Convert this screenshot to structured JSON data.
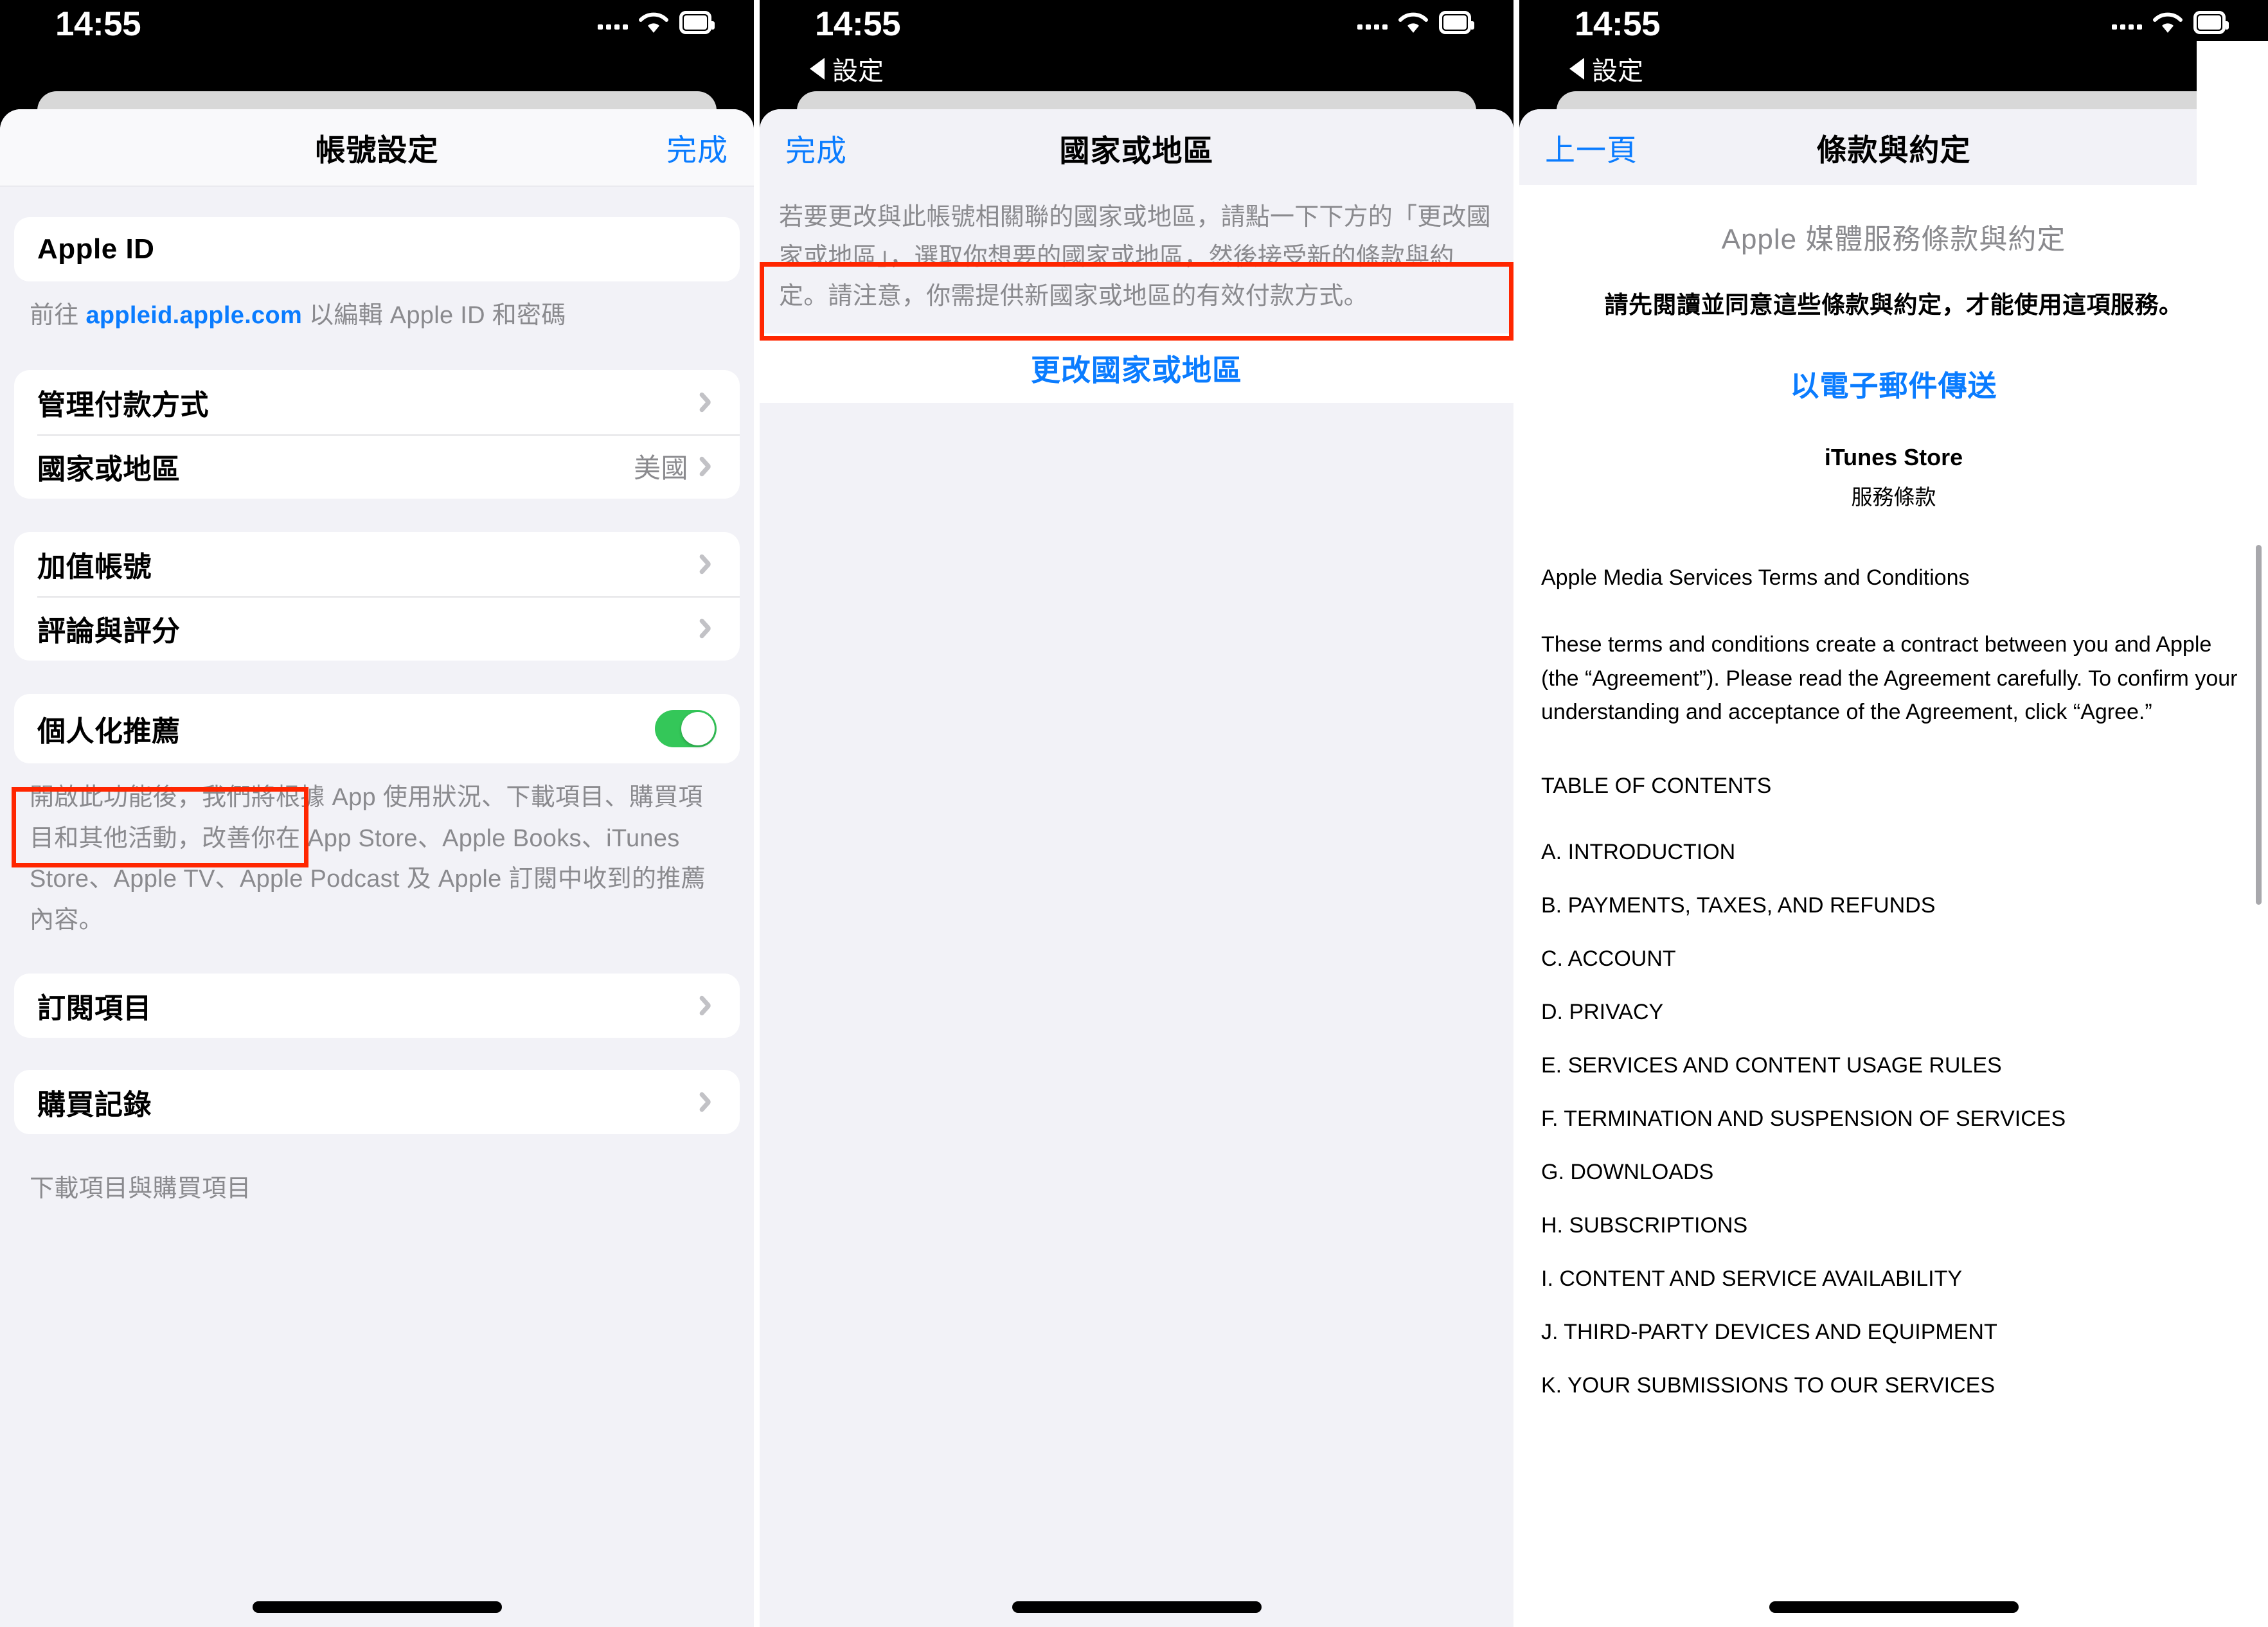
{
  "statusbar": {
    "time": "14:55",
    "signal_dots": 4,
    "wifi_icon": "wifi-icon",
    "battery_icon": "battery-icon"
  },
  "back_chip": {
    "label": "設定",
    "icon": "back-triangle-icon"
  },
  "panel1": {
    "nav": {
      "title": "帳號設定",
      "done_label": "完成"
    },
    "apple_id_row": {
      "label": "Apple ID"
    },
    "apple_id_footnote": {
      "prefix": "前往 ",
      "link": "appleid.apple.com",
      "suffix": " 以編輯 Apple ID 和密碼"
    },
    "group_a": [
      {
        "label": "管理付款方式",
        "value": "",
        "accessory": "chevron"
      },
      {
        "label": "國家或地區",
        "value": "美國",
        "accessory": "chevron",
        "highlighted": true
      }
    ],
    "group_b": [
      {
        "label": "加值帳號",
        "value": "",
        "accessory": "chevron"
      },
      {
        "label": "評論與評分",
        "value": "",
        "accessory": "chevron"
      }
    ],
    "group_c": [
      {
        "label": "個人化推薦",
        "value": "",
        "accessory": "toggle",
        "toggle_on": true
      }
    ],
    "personalized_footnote": "開啟此功能後，我們將根據 App 使用狀況、下載項目、購買項目和其他活動，改善你在 App Store、Apple Books、iTunes Store、Apple TV、Apple Podcast 及 Apple 訂閱中收到的推薦內容。",
    "group_d": [
      {
        "label": "訂閱項目",
        "value": "",
        "accessory": "chevron"
      }
    ],
    "group_e": [
      {
        "label": "購買記錄",
        "value": "",
        "accessory": "chevron"
      }
    ],
    "bottom_footnote": "下載項目與購買項目"
  },
  "panel2": {
    "nav": {
      "title": "國家或地區",
      "done_label": "完成"
    },
    "description": "若要更改與此帳號相關聯的國家或地區，請點一下下方的「更改國家或地區」，選取你想要的國家或地區，然後接受新的條款與約定。請注意，你需提供新國家或地區的有效付款方式。",
    "change_button_label": "更改國家或地區"
  },
  "panel3": {
    "nav": {
      "title": "條款與約定",
      "back_label": "上一頁"
    },
    "doc": {
      "heading": "Apple 媒體服務條款與約定",
      "subheading": "請先閱讀並同意這些條款與約定，才能使用這項服務。",
      "email_link": "以電子郵件傳送",
      "store_name": "iTunes Store",
      "store_sub": "服務條款",
      "section_title": "Apple Media Services Terms and Conditions",
      "paragraph": "These terms and conditions create a contract between you and Apple (the “Agreement”). Please read the Agreement carefully. To confirm your understanding and acceptance of the Agreement, click “Agree.”",
      "toc_title": "TABLE OF CONTENTS",
      "toc_items": [
        "A. INTRODUCTION",
        "B. PAYMENTS, TAXES, AND REFUNDS",
        "C. ACCOUNT",
        "D. PRIVACY",
        "E. SERVICES AND CONTENT USAGE RULES",
        "F. TERMINATION AND SUSPENSION OF SERVICES",
        "G. DOWNLOADS",
        "H. SUBSCRIPTIONS",
        "I. CONTENT AND SERVICE AVAILABILITY",
        "J. THIRD-PARTY DEVICES AND EQUIPMENT",
        "K. YOUR SUBMISSIONS TO OUR SERVICES"
      ]
    }
  },
  "colors": {
    "accent_blue": "#0a7cff",
    "toggle_green": "#34c759",
    "highlight_red": "#ff2600",
    "group_bg": "#f2f2f7",
    "secondary_text": "#8a8a8e"
  }
}
